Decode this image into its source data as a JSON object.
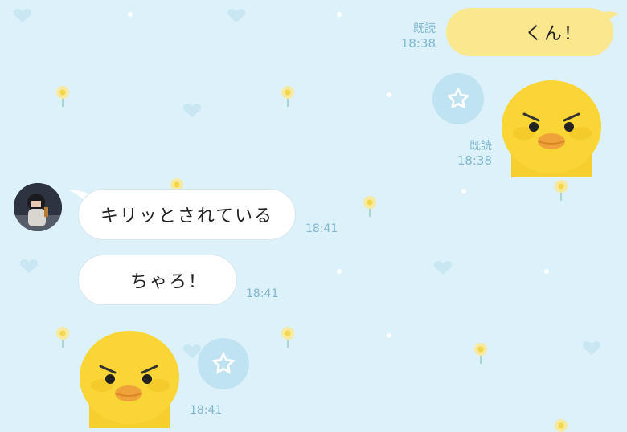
{
  "messages": [
    {
      "id": "m1",
      "direction": "outgoing",
      "type": "text",
      "text": "くん！",
      "read_label": "既読",
      "time": "18:38"
    },
    {
      "id": "m2",
      "direction": "outgoing",
      "type": "sticker",
      "sticker": "angry-yellow-chick-sticker",
      "read_label": "既読",
      "time": "18:38"
    },
    {
      "id": "m3",
      "direction": "incoming",
      "type": "text",
      "text": "キリッとされている",
      "time": "18:41"
    },
    {
      "id": "m4",
      "direction": "incoming",
      "type": "text",
      "text": "ちゃろ！",
      "time": "18:41"
    },
    {
      "id": "m5",
      "direction": "incoming",
      "type": "sticker",
      "sticker": "angry-yellow-chick-sticker",
      "time": "18:41"
    }
  ],
  "icons": {
    "sticker_action": "star-icon",
    "avatar": "sender-avatar"
  },
  "colors": {
    "background": "#dcf1fa",
    "outgoing_bubble": "#fbe78e",
    "incoming_bubble": "#ffffff",
    "meta_text": "#7fb8cf",
    "star_button": "#c0e3f1"
  }
}
